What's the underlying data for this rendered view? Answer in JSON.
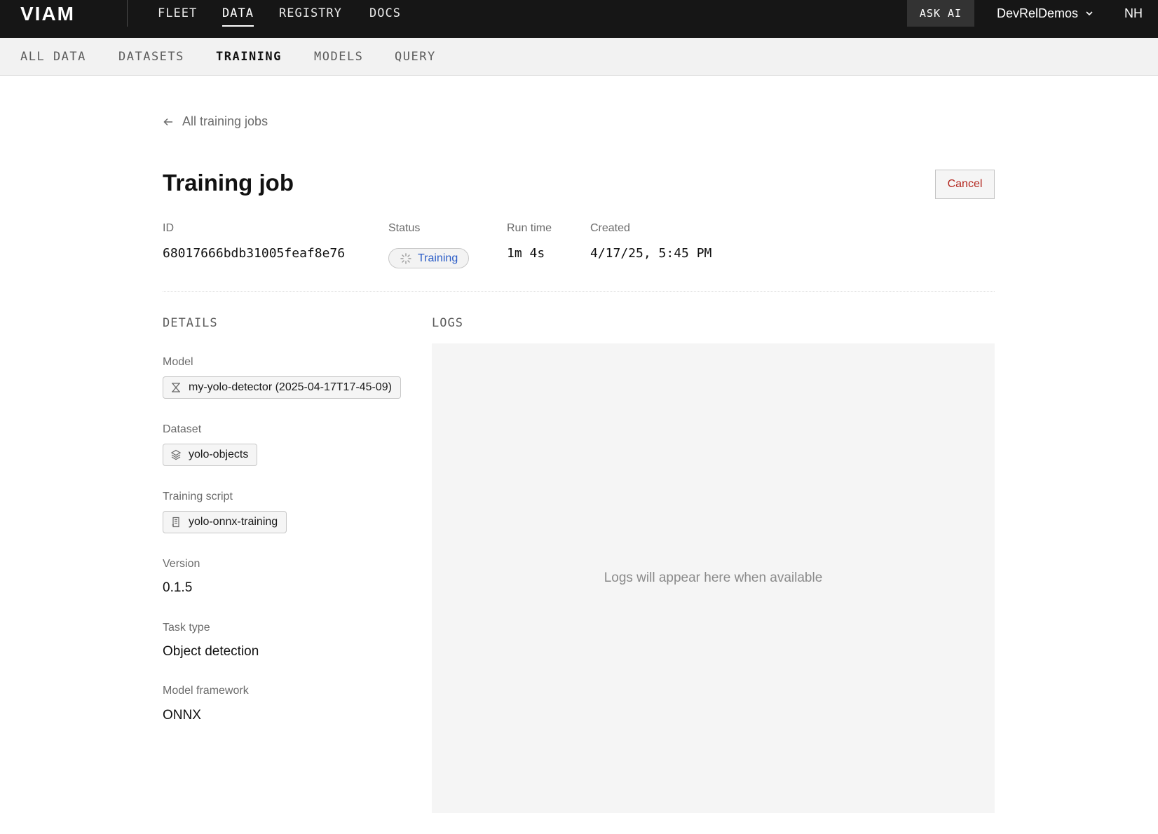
{
  "brand": {
    "logo_text": "VIAM"
  },
  "topnav": {
    "items": [
      {
        "label": "FLEET"
      },
      {
        "label": "DATA"
      },
      {
        "label": "REGISTRY"
      },
      {
        "label": "DOCS"
      }
    ],
    "active": "DATA",
    "ask_ai": "ASK AI",
    "org": "DevRelDemos",
    "user_initials": "NH"
  },
  "subnav": {
    "items": [
      {
        "label": "ALL DATA"
      },
      {
        "label": "DATASETS"
      },
      {
        "label": "TRAINING"
      },
      {
        "label": "MODELS"
      },
      {
        "label": "QUERY"
      }
    ],
    "active": "TRAINING"
  },
  "back_link": "All training jobs",
  "page_title": "Training job",
  "cancel_button": "Cancel",
  "meta": {
    "id_label": "ID",
    "id_value": "68017666bdb31005feaf8e76",
    "status_label": "Status",
    "status_value": "Training",
    "runtime_label": "Run time",
    "runtime_value": "1m 4s",
    "created_label": "Created",
    "created_value": "4/17/25, 5:45 PM"
  },
  "details": {
    "heading": "DETAILS",
    "model_label": "Model",
    "model_value": "my-yolo-detector (2025-04-17T17-45-09)",
    "dataset_label": "Dataset",
    "dataset_value": "yolo-objects",
    "script_label": "Training script",
    "script_value": "yolo-onnx-training",
    "version_label": "Version",
    "version_value": "0.1.5",
    "task_label": "Task type",
    "task_value": "Object detection",
    "framework_label": "Model framework",
    "framework_value": "ONNX"
  },
  "logs": {
    "heading": "LOGS",
    "empty_message": "Logs will appear here when available"
  },
  "colors": {
    "topbar_bg": "#161616",
    "cancel_text": "#b3261e",
    "status_text": "#2a5cc7"
  }
}
